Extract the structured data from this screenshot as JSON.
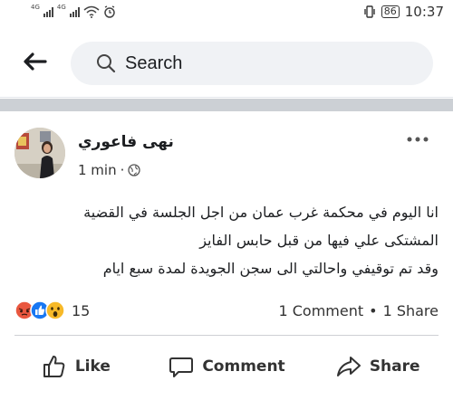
{
  "status_bar": {
    "network_1": "4G",
    "network_2": "4G",
    "battery": "86",
    "time": "10:37"
  },
  "header": {
    "search_placeholder": "Search"
  },
  "post": {
    "author": "نهى فاعوري",
    "time": "1 min",
    "privacy_icon": "globe-icon",
    "text_lines": [
      "انا اليوم في محكمة غرب عمان من اجل الجلسة في القضية",
      "المشتكى علي فيها من قبل   حابس الفايز",
      "وقد تم توقيفي واحالتي الى سجن الجويدة لمدة سبع ايام"
    ],
    "reactions": {
      "icons": [
        "angry-icon",
        "like-icon",
        "wow-icon"
      ],
      "count": "15"
    },
    "comments": "1 Comment",
    "separator": "•",
    "shares": "1 Share",
    "actions": {
      "like": "Like",
      "comment": "Comment",
      "share": "Share"
    }
  },
  "colors": {
    "facebook_blue": "#1877f2",
    "angry": "#e9573f",
    "wow": "#f7b928",
    "separator_band": "#ccd0d5"
  }
}
